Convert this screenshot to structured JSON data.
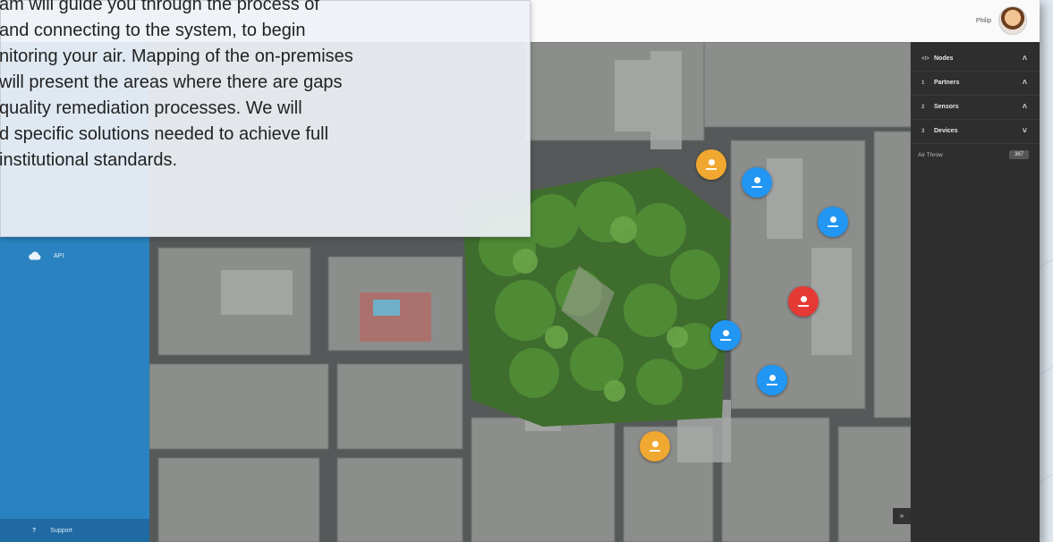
{
  "tooltip": {
    "lines": [
      "am will guide you through the process of",
      "and connecting to the system, to begin",
      "nitoring your air. Mapping of the on-premises",
      " will present the areas where there are gaps",
      " quality remediation processes. We will",
      "d specific solutions needed to achieve full",
      " institutional standards."
    ]
  },
  "header": {
    "user_name": "Philip"
  },
  "sidebar": {
    "api_label": "API",
    "support_label": "Support",
    "support_icon": "?"
  },
  "right_panel": {
    "items": [
      {
        "icon": "</>",
        "label": "Nodes",
        "chevron": "˄"
      },
      {
        "icon": "1",
        "label": "Partners",
        "chevron": "˄"
      },
      {
        "icon": "2",
        "label": "Sensors",
        "chevron": "˄"
      },
      {
        "icon": "3",
        "label": "Devices",
        "chevron": "˅"
      }
    ],
    "air_label": "Air Throw",
    "air_value": "367"
  },
  "map": {
    "collapse_icon": "»",
    "markers": [
      {
        "color": "#f0a830",
        "status": "warning"
      },
      {
        "color": "#2196f3",
        "status": "normal"
      },
      {
        "color": "#2196f3",
        "status": "normal"
      },
      {
        "color": "#e53935",
        "status": "alert"
      },
      {
        "color": "#2196f3",
        "status": "normal"
      },
      {
        "color": "#2196f3",
        "status": "normal"
      },
      {
        "color": "#f0a830",
        "status": "warning"
      }
    ]
  }
}
